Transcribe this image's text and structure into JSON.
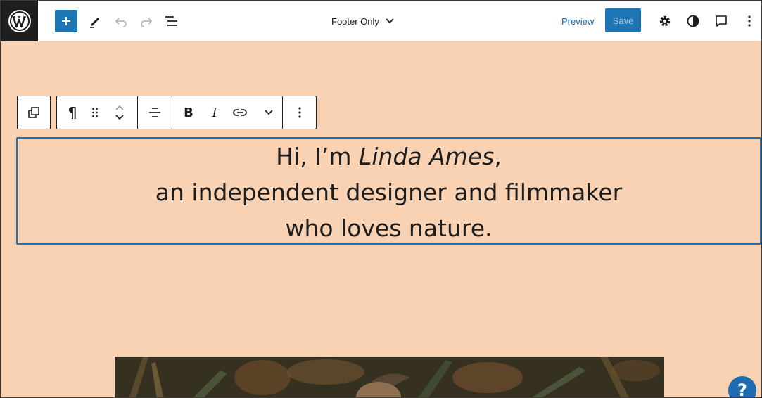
{
  "header": {
    "document_title": "Footer Only",
    "preview_label": "Preview",
    "save_label": "Save"
  },
  "block_toolbar": {
    "paragraph_symbol": "¶",
    "bold_label": "B",
    "italic_label": "I"
  },
  "paragraph": {
    "line1_prefix": "Hi, I’m ",
    "line1_name": "Linda Ames",
    "line1_suffix": ",",
    "line2": "an independent designer and filmmaker",
    "line3": "who loves nature."
  },
  "help": {
    "label": "?"
  },
  "colors": {
    "canvas_bg": "#f9d2b4",
    "accent": "#1e75b4",
    "selection_border": "#2271b1"
  }
}
